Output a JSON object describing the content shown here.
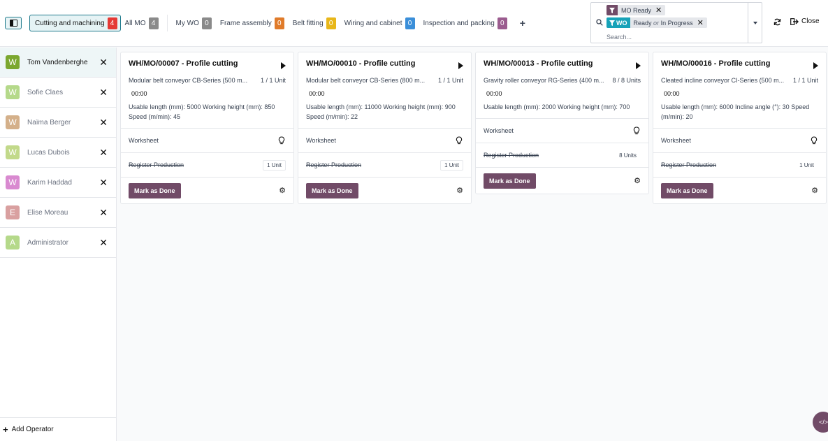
{
  "workcenter_tabs": [
    {
      "label": "Cutting and machining",
      "count": "4",
      "color": "#e53935",
      "active": true
    },
    {
      "label": "All MO",
      "count": "4",
      "color": "#8a8a8a"
    },
    {
      "label": "My WO",
      "count": "0",
      "color": "#8a8a8a"
    },
    {
      "label": "Frame assembly",
      "count": "0",
      "color": "#e07b2a"
    },
    {
      "label": "Belt fitting",
      "count": "0",
      "color": "#e8b71a"
    },
    {
      "label": "Wiring and cabinet",
      "count": "0",
      "color": "#3b8fd9"
    },
    {
      "label": "Inspection and packing",
      "count": "0",
      "color": "#9b5c8f"
    }
  ],
  "search": {
    "facet_mo": {
      "label": "MO Ready"
    },
    "facet_wo": {
      "tag": "WO",
      "value_a": "Ready",
      "sep": "or",
      "value_b": "In Progress"
    },
    "placeholder": "Search..."
  },
  "header": {
    "close_label": "Close"
  },
  "operators": [
    {
      "initial": "W",
      "name": "Tom Vandenberghe",
      "color": "#7ba72f",
      "active": true
    },
    {
      "initial": "W",
      "name": "Sofie Claes",
      "color": "#b5d98a"
    },
    {
      "initial": "W",
      "name": "Naïma Berger",
      "color": "#d4b08a"
    },
    {
      "initial": "W",
      "name": "Lucas Dubois",
      "color": "#c2d98a"
    },
    {
      "initial": "W",
      "name": "Karim Haddad",
      "color": "#d98ad0"
    },
    {
      "initial": "E",
      "name": "Elise Moreau",
      "color": "#d9a0a0"
    },
    {
      "initial": "A",
      "name": "Administrator",
      "color": "#b5d98a"
    }
  ],
  "sidebar": {
    "add_operator_label": "Add Operator"
  },
  "cards": [
    {
      "title": "WH/MO/00007 - Profile cutting",
      "product": "Modular belt conveyor CB-Series (500 m...",
      "qty": "1 / 1 Unit",
      "timer": "00:00",
      "attributes": "Usable length (mm): 5000 Working height (mm): 850 Speed (m/min): 45",
      "worksheet": "Worksheet",
      "register": "Register Production",
      "register_qty": "1 Unit",
      "done": "Mark as Done"
    },
    {
      "title": "WH/MO/00010 - Profile cutting",
      "product": "Modular belt conveyor CB-Series (800 m...",
      "qty": "1 / 1 Unit",
      "timer": "00:00",
      "attributes": "Usable length (mm): 11000 Working height (mm): 900 Speed (m/min): 22",
      "worksheet": "Worksheet",
      "register": "Register Production",
      "register_qty": "1 Unit",
      "done": "Mark as Done"
    },
    {
      "title": "WH/MO/00013 - Profile cutting",
      "product": "Gravity roller conveyor RG-Series (400 m...",
      "qty": "8 / 8 Units",
      "timer": "00:00",
      "attributes": "Usable length (mm): 2000 Working height (mm): 700",
      "worksheet": "Worksheet",
      "register": "Register Production",
      "register_qty": "8 Units",
      "done": "Mark as Done"
    },
    {
      "title": "WH/MO/00016 - Profile cutting",
      "product": "Cleated incline conveyor CI-Series (500 m...",
      "qty": "1 / 1 Unit",
      "timer": "00:00",
      "attributes": "Usable length (mm): 6000 Incline angle (°): 30 Speed (m/min): 20",
      "worksheet": "Worksheet",
      "register": "Register Production",
      "register_qty": "1 Unit",
      "done": "Mark as Done"
    }
  ],
  "colors": {
    "accent": "#1f7a8c",
    "brand": "#714b67",
    "wo_tag": "#17a2b8",
    "mo_tag": "#714b67"
  },
  "icons": {
    "sidebar_toggle": "sidebar-toggle-icon",
    "search": "search-icon",
    "refresh": "refresh-icon",
    "close": "sign-out-icon",
    "play": "play-icon",
    "bulb": "lightbulb-icon",
    "gear": "gear-icon",
    "debug": "code-icon"
  }
}
